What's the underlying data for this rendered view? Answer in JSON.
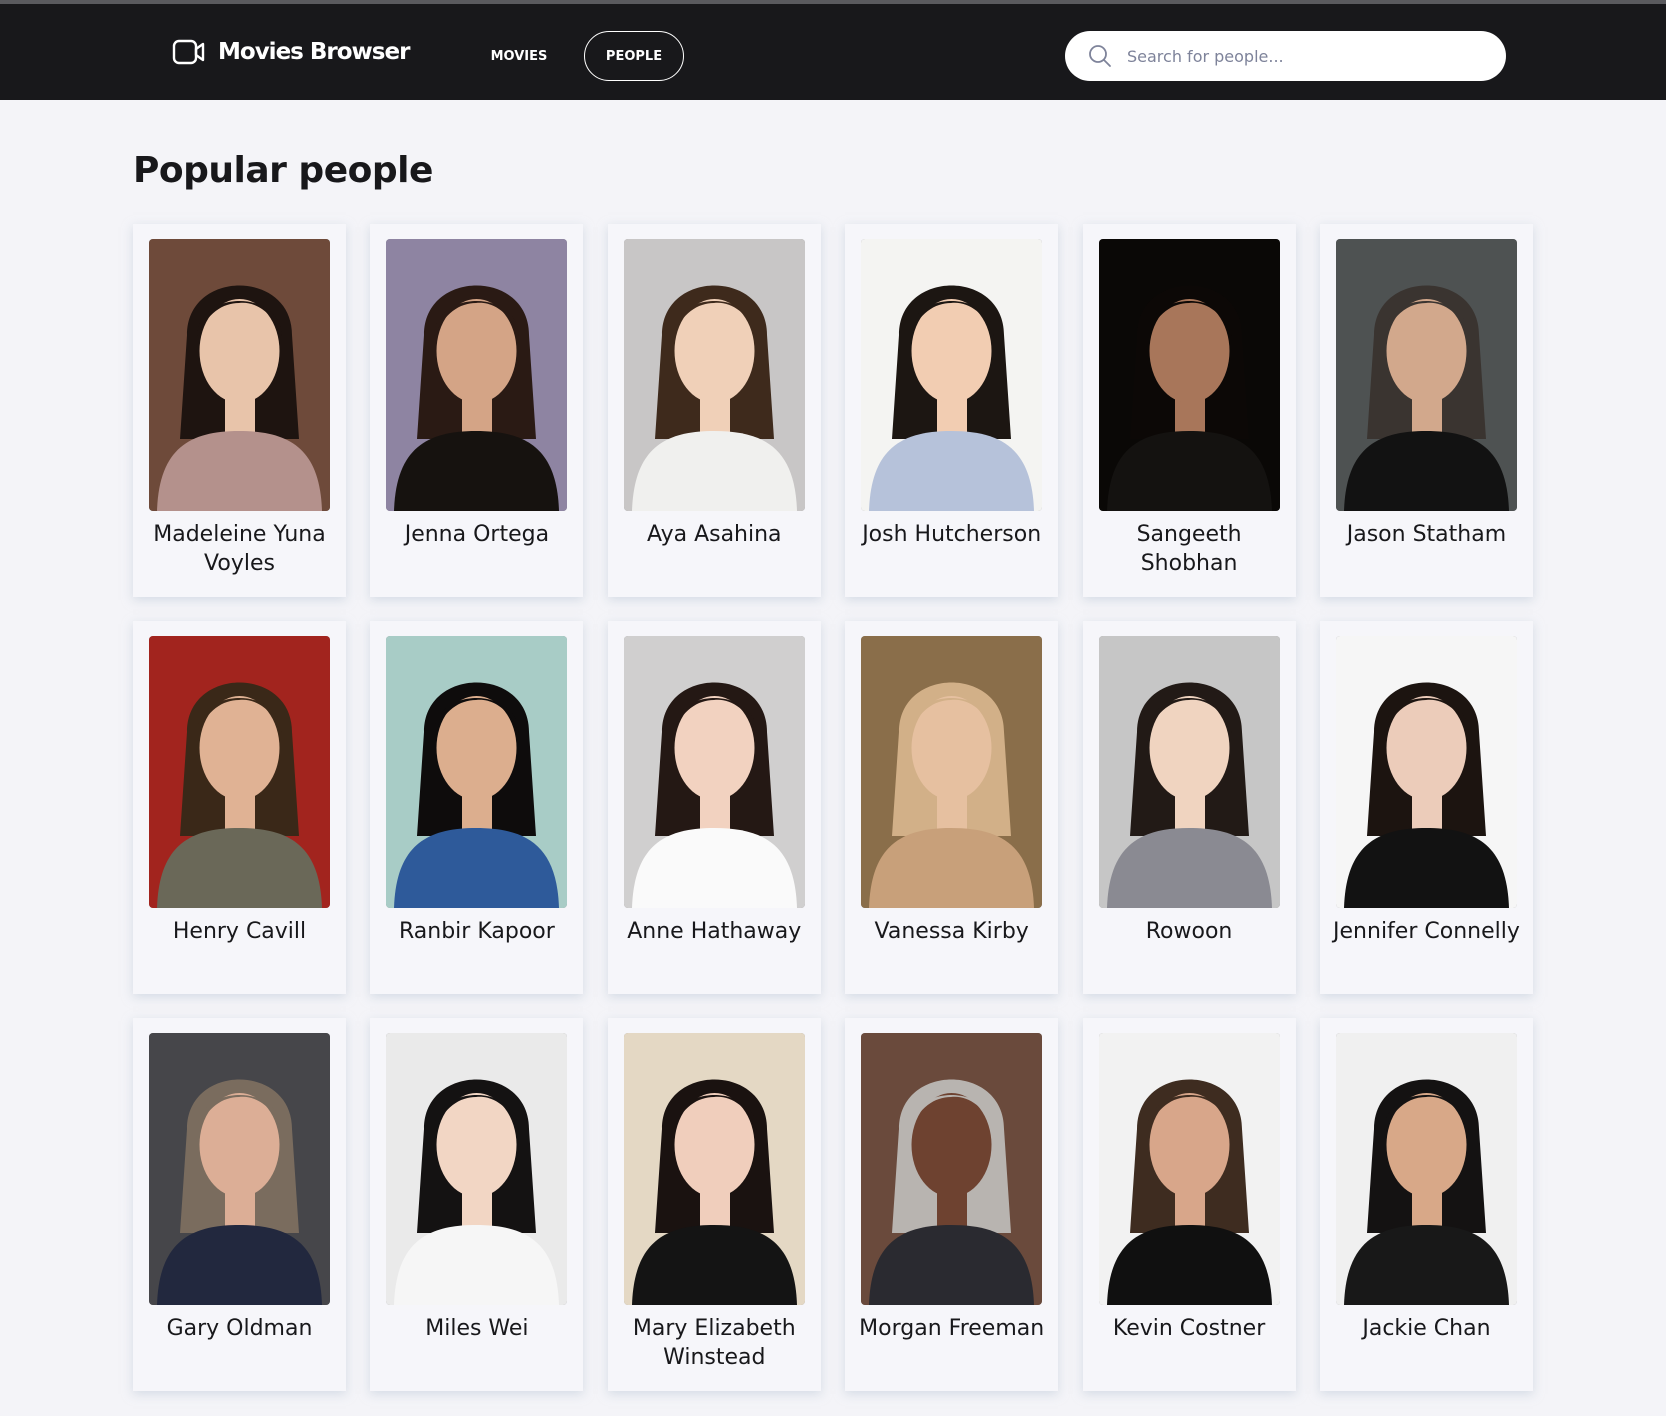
{
  "header": {
    "brand_icon": "video-camera-icon",
    "brand": "Movies Browser",
    "nav": {
      "movies": "MOVIES",
      "people": "PEOPLE"
    },
    "active_nav": "people",
    "search": {
      "icon": "search-icon",
      "placeholder": "Search for people..."
    }
  },
  "main": {
    "title": "Popular people",
    "people": [
      {
        "name": "Madeleine Yuna Voyles",
        "bg": "#6e4a3a",
        "skin": "#e8c4aa",
        "hair": "#1e1410",
        "shirt": "#b4918c"
      },
      {
        "name": "Jenna Ortega",
        "bg": "#8e84a2",
        "skin": "#d4a486",
        "hair": "#2a1a14",
        "shirt": "#16120f"
      },
      {
        "name": "Aya Asahina",
        "bg": "#c8c6c6",
        "skin": "#f0d0b8",
        "hair": "#3e2a1c",
        "shirt": "#f0f0ee"
      },
      {
        "name": "Josh Hutcherson",
        "bg": "#f4f4f2",
        "skin": "#f2cdb2",
        "hair": "#1c1612",
        "shirt": "#b6c2da"
      },
      {
        "name": "Sangeeth Shobhan",
        "bg": "#0a0806",
        "skin": "#a8765a",
        "hair": "#0c0806",
        "shirt": "#141210"
      },
      {
        "name": "Jason Statham",
        "bg": "#4e5252",
        "skin": "#d2a88c",
        "hair": "#3a3430",
        "shirt": "#121212"
      },
      {
        "name": "Henry Cavill",
        "bg": "#a2241e",
        "skin": "#e0b294",
        "hair": "#3a2818",
        "shirt": "#6a6858"
      },
      {
        "name": "Ranbir Kapoor",
        "bg": "#a8ccc6",
        "skin": "#dcae8e",
        "hair": "#0e0c0c",
        "shirt": "#2e5a9a"
      },
      {
        "name": "Anne Hathaway",
        "bg": "#d0cfcf",
        "skin": "#f2d2c0",
        "hair": "#241814",
        "shirt": "#fafafa"
      },
      {
        "name": "Vanessa Kirby",
        "bg": "#8a6e4a",
        "skin": "#e6c0a0",
        "hair": "#d2b088",
        "shirt": "#c8a07a"
      },
      {
        "name": "Rowoon",
        "bg": "#c6c6c6",
        "skin": "#f0d4c0",
        "hair": "#221a16",
        "shirt": "#8a8a92"
      },
      {
        "name": "Jennifer Connelly",
        "bg": "#f6f6f6",
        "skin": "#ecccba",
        "hair": "#1c1410",
        "shirt": "#121212"
      },
      {
        "name": "Gary Oldman",
        "bg": "#46464a",
        "skin": "#dcae96",
        "hair": "#7a6c5e",
        "shirt": "#22283e"
      },
      {
        "name": "Miles Wei",
        "bg": "#eaeaea",
        "skin": "#f2d6c4",
        "hair": "#141212",
        "shirt": "#f6f6f6"
      },
      {
        "name": "Mary Elizabeth Winstead",
        "bg": "#e4d8c4",
        "skin": "#f0cebc",
        "hair": "#1a1210",
        "shirt": "#141414"
      },
      {
        "name": "Morgan Freeman",
        "bg": "#6a4a3c",
        "skin": "#6e4230",
        "hair": "#b8b4b0",
        "shirt": "#2a2a30"
      },
      {
        "name": "Kevin Costner",
        "bg": "#f2f2f2",
        "skin": "#d8a68a",
        "hair": "#3e2c20",
        "shirt": "#101010"
      },
      {
        "name": "Jackie Chan",
        "bg": "#f0f0f0",
        "skin": "#d8a888",
        "hair": "#141212",
        "shirt": "#181818"
      }
    ]
  }
}
